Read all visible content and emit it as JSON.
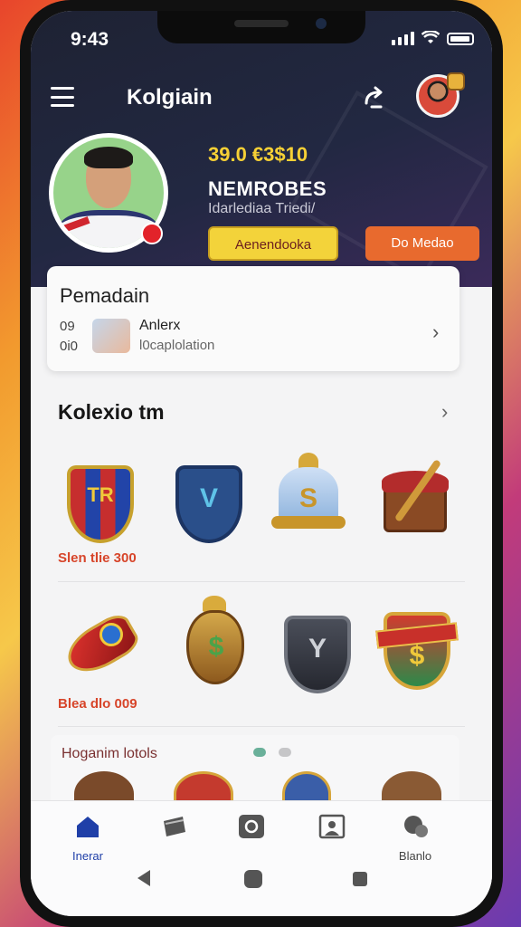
{
  "status_bar": {
    "time": "9:43"
  },
  "header": {
    "app_title": "Kolgiain",
    "stat_value": "39.0 €3$10",
    "profile_name": "NEMROBES",
    "profile_subtitle": "Idarlediaa Triedi/",
    "primary_button": "Aenendooka",
    "secondary_button": "Do Medao"
  },
  "card": {
    "title": "Pemadain",
    "num_top": "09",
    "num_bottom": "0i0",
    "item_name": "Anlerx",
    "item_desc": "l0caplolation"
  },
  "collection": {
    "title": "Kolexio tm",
    "row1_price": "Slen tlie 300",
    "row2_price": "Blea dlo 009",
    "items": [
      {
        "icon": "striped-shield-icon",
        "glyph": "TR"
      },
      {
        "icon": "blue-shield-icon",
        "glyph": "V"
      },
      {
        "icon": "gold-bell-icon",
        "glyph": "S"
      },
      {
        "icon": "treasure-chest-icon",
        "glyph": ""
      },
      {
        "icon": "red-gem-bullet-icon",
        "glyph": ""
      },
      {
        "icon": "gold-urn-icon",
        "glyph": "$"
      },
      {
        "icon": "dark-shield-icon",
        "glyph": "Y"
      },
      {
        "icon": "crest-emblem-icon",
        "glyph": "$"
      }
    ]
  },
  "promo": {
    "title": "Hoganim lotols"
  },
  "nav": {
    "items": [
      {
        "label": "Inerar",
        "icon": "home-icon"
      },
      {
        "label": "",
        "icon": "wallet-icon"
      },
      {
        "label": "",
        "icon": "camera-icon"
      },
      {
        "label": "",
        "icon": "photo-frame-icon"
      },
      {
        "label": "Blanlo",
        "icon": "chat-bubble-icon"
      }
    ]
  },
  "colors": {
    "header_bg": "#222842",
    "accent_yellow": "#f3d33a",
    "accent_orange": "#e86a2e",
    "nav_active": "#1f3fa8"
  }
}
